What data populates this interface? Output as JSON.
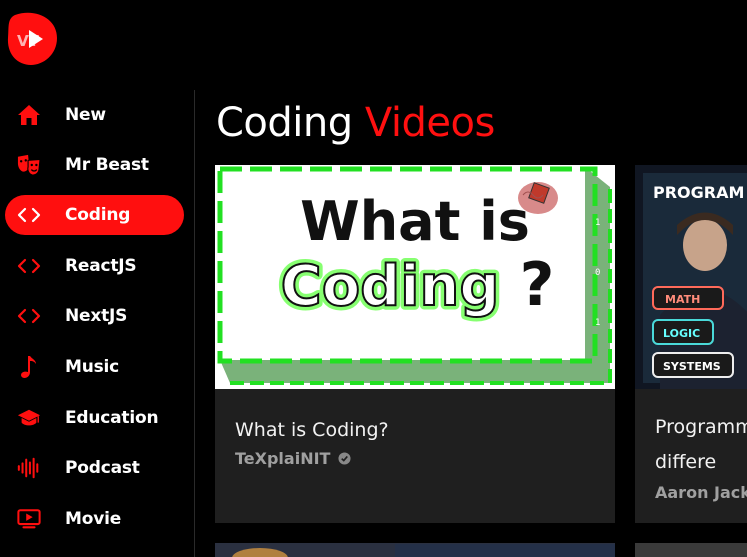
{
  "app": {
    "logo_text": "VT",
    "brand_color": "#ff0f0f"
  },
  "sidebar": {
    "items": [
      {
        "label": "New",
        "icon": "home-icon"
      },
      {
        "label": "Mr Beast",
        "icon": "theater-masks-icon"
      },
      {
        "label": "Coding",
        "icon": "code-icon",
        "active": true
      },
      {
        "label": "ReactJS",
        "icon": "code-icon"
      },
      {
        "label": "NextJS",
        "icon": "code-icon"
      },
      {
        "label": "Music",
        "icon": "music-note-icon"
      },
      {
        "label": "Education",
        "icon": "graduation-cap-icon"
      },
      {
        "label": "Podcast",
        "icon": "waveform-icon"
      },
      {
        "label": "Movie",
        "icon": "tv-play-icon"
      }
    ]
  },
  "main": {
    "title_part1": "Coding",
    "title_part2": "Videos",
    "videos": [
      {
        "title": "What is Coding?",
        "channel": "TeXplaiNIT",
        "verified": true,
        "thumbnail": {
          "line1": "What is",
          "line2": "Coding",
          "mark": "?"
        }
      },
      {
        "title": "Programm the differe",
        "channel": "Aaron Jack",
        "thumbnail": {
          "banner": "PROGRAM",
          "tags": [
            "MATH",
            "LOGIC",
            "SYSTEMS"
          ]
        }
      }
    ]
  }
}
